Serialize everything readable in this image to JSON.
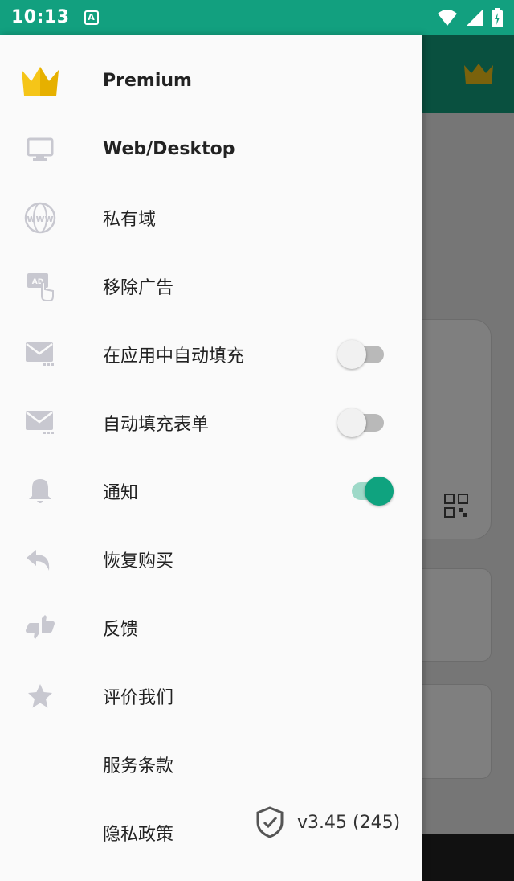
{
  "status_bar": {
    "time": "10:13",
    "notification_icon": "a-letter-icon",
    "icons": [
      "wifi-icon",
      "cellular-signal-icon",
      "battery-icon"
    ]
  },
  "colors": {
    "accent": "#12a07f",
    "toggle_on": "#0fa37f",
    "premium_crown": "#f5c518",
    "icon_grey": "#c8c8d0"
  },
  "drawer": {
    "items": [
      {
        "label": "Premium",
        "icon": "crown-icon"
      },
      {
        "label": "Web/Desktop",
        "icon": "monitor-icon"
      },
      {
        "label": "私有域",
        "icon": "www-globe-icon"
      },
      {
        "label": "移除广告",
        "icon": "ad-tap-icon"
      },
      {
        "label": "在应用中自动填充",
        "icon": "mail-dots-icon",
        "toggle": false
      },
      {
        "label": "自动填充表单",
        "icon": "mail-dots-icon",
        "toggle": false
      },
      {
        "label": "通知",
        "icon": "bell-icon",
        "toggle": true
      },
      {
        "label": "恢复购买",
        "icon": "undo-arrow-icon"
      },
      {
        "label": "反馈",
        "icon": "thumbs-icon"
      },
      {
        "label": "评价我们",
        "icon": "star-icon"
      },
      {
        "label": "服务条款",
        "icon": ""
      },
      {
        "label": "隐私政策",
        "icon": ""
      }
    ],
    "version": "v3.45 (245)",
    "version_icon": "shield-check-icon"
  }
}
